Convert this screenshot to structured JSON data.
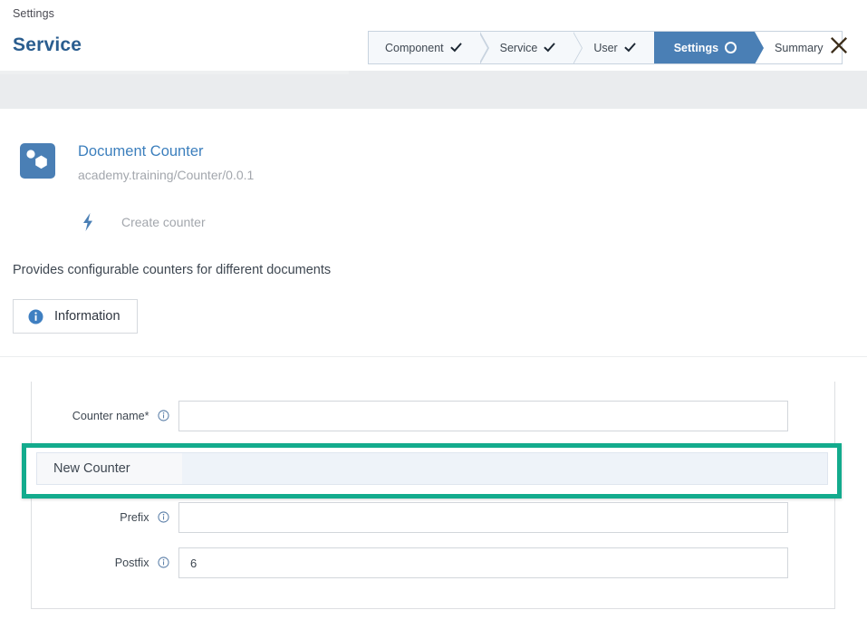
{
  "header": {
    "breadcrumb": "Settings",
    "title": "Service",
    "close_icon": "close-icon"
  },
  "wizard": {
    "steps": [
      {
        "label": "Component",
        "state": "done",
        "icon": "check-icon"
      },
      {
        "label": "Service",
        "state": "done",
        "icon": "check-icon"
      },
      {
        "label": "User",
        "state": "done",
        "icon": "check-icon"
      },
      {
        "label": "Settings",
        "state": "active",
        "icon": "circle-icon"
      },
      {
        "label": "Summary",
        "state": "pending",
        "icon": ""
      }
    ],
    "active_color": "#4a7fb5",
    "border_color": "#c8d3df"
  },
  "service": {
    "icon": "hexagon-dot-icon",
    "name": "Document Counter",
    "identifier": "academy.training/Counter/0.0.1",
    "action_icon": "lightning-bolt-icon",
    "action_label": "Create counter",
    "description": "Provides configurable counters for different documents",
    "info_button": {
      "label": "Information",
      "icon": "info-circle-icon"
    }
  },
  "form": {
    "fields": [
      {
        "label": "Counter name*",
        "info_icon": "info-outline-icon",
        "value": "",
        "placeholder": ""
      },
      {
        "label": "Prefix",
        "info_icon": "info-outline-icon",
        "value": "",
        "placeholder": ""
      },
      {
        "label": "Postfix",
        "info_icon": "info-outline-icon",
        "value": "6",
        "placeholder": ""
      }
    ]
  },
  "highlight": {
    "border_color": "#13ab8d",
    "suggestion_label": "New Counter"
  }
}
